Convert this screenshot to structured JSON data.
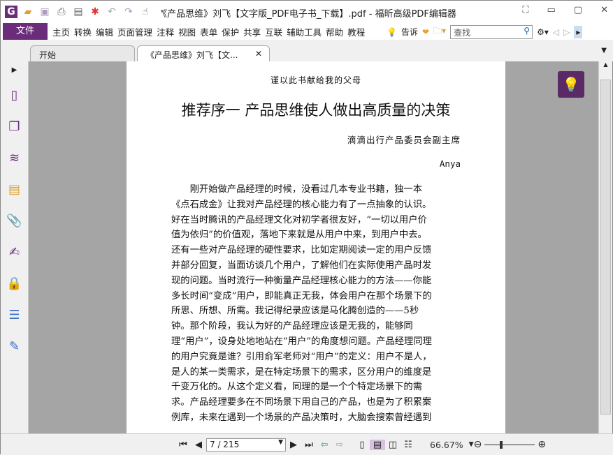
{
  "window": {
    "title": "《产品思维》刘飞【文字版_PDF电子书_下载】.pdf - 福昕高级PDF编辑器"
  },
  "menu": {
    "file": "文件",
    "items": [
      "主页",
      "转换",
      "编辑",
      "页面管理",
      "注释",
      "视图",
      "表单",
      "保护",
      "共享",
      "互联",
      "辅助工具",
      "帮助",
      "教程"
    ],
    "tell": "告诉",
    "search_placeholder": "查找"
  },
  "tabs": [
    {
      "label": "开始"
    },
    {
      "label": "《产品思维》刘飞【文..."
    }
  ],
  "page": {
    "dedication": "谨以此书献给我的父母",
    "heading": "推荐序一 产品思维使人做出高质量的决策",
    "subtitle": "滴滴出行产品委员会副主席",
    "author": "Anya",
    "lines": [
      "　　刚开始做产品经理的时候，没看过几本专业书籍，独一本",
      "《点石成金》让我对产品经理的核心能力有了一点抽象的认识。",
      "好在当时腾讯的产品经理文化对初学者很友好，“一切以用户价",
      "值为依归”的价值观，落地下来就是从用户中来，到用户中去。",
      "还有一些对产品经理的硬性要求，比如定期阅读一定的用户反馈",
      "并部分回复，当面访谈几个用户，了解他们在实际使用产品时发",
      "现的问题。当时流行一种衡量产品经理核心能力的方法——你能",
      "多长时间“变成”用户，即能真正无我，体会用户在那个场景下的",
      "所思、所想、所需。我记得纪录应该是马化腾创造的——5秒",
      "钟。那个阶段，我认为好的产品经理应该是无我的，能够同",
      "理“用户”，设身处地地站在“用户”的角度想问题。产品经理同理",
      "的用户究竟是谁？引用俞军老师对“用户”的定义：用户不是人，",
      "是人的某一类需求，是在特定场景下的需求，区分用户的维度是",
      "千变万化的。从这个定义看，同理的是一个个特定场景下的需",
      "求。产品经理要多在不同场景下用自己的产品，也是为了积累案",
      "例库，未来在遇到一个场景的产品决策时，大脑会搜索曾经遇到"
    ]
  },
  "status": {
    "page": "7 / 215",
    "zoom": "66.67%"
  }
}
